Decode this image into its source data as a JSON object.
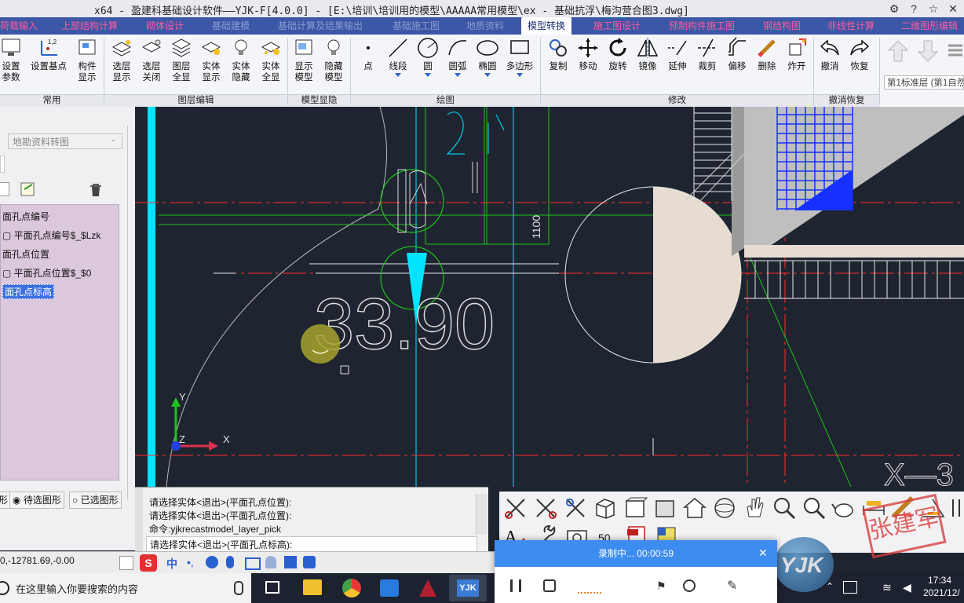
{
  "window": {
    "title": "x64 - 盈建科基础设计软件——YJK-F[4.0.0] - [E:\\培训\\培训用的模型\\AAAAA常用模型\\ex - 基础抗浮\\梅沟营合图3.dwg]"
  },
  "tabs": [
    {
      "label": "荷载输入"
    },
    {
      "label": "上部结构计算"
    },
    {
      "label": "砌体设计"
    },
    {
      "label": "基础建模"
    },
    {
      "label": "基础计算及结果输出"
    },
    {
      "label": "基础施工图"
    },
    {
      "label": "地质资料"
    },
    {
      "label": "模型转换"
    },
    {
      "label": "施工图设计"
    },
    {
      "label": "预制构件施工图"
    },
    {
      "label": "钢结构图"
    },
    {
      "label": "非线性计算"
    },
    {
      "label": "二维图形编辑"
    }
  ],
  "ribbon": {
    "buttons": {
      "set_params": "设置\n参数",
      "set_base": "设置基点",
      "component_show": "构件\n显示",
      "select_layer_show": "选层\n显示",
      "select_layer_close": "选层\n关闭",
      "layer_all": "图层\n全显",
      "entity_show": "实体\n显示",
      "entity_hide": "实体\n隐藏",
      "entity_all": "实体\n全显",
      "show_model": "显示\n模型",
      "hide_model": "隐藏\n模型",
      "point": "点",
      "line": "线段",
      "circle": "圆",
      "arc": "圆弧",
      "ellipse": "椭圆",
      "polygon": "多边形",
      "copy": "复制",
      "move": "移动",
      "rotate": "旋转",
      "mirror": "镜像",
      "extend": "延伸",
      "trim": "裁剪",
      "offset": "偏移",
      "delete": "删除",
      "explode": "炸开",
      "undo": "撤消",
      "redo": "恢复"
    },
    "groups": {
      "common": "常用",
      "layer_edit": "图层编辑",
      "model_hide": "模型显隐",
      "draw": "绘图",
      "modify": "修改",
      "undo_redo": "撤消恢复"
    },
    "floor": "第1标准层 (第1自然"
  },
  "left_panel": {
    "combo": "地勘资料转图",
    "layers": [
      "面孔点编号",
      "平面孔点编号$_$Lzk",
      "面孔点位置",
      "平面孔点位置$_$0",
      "面孔点标高"
    ],
    "radio_pending": "待选图形",
    "radio_selected": "已选图形"
  },
  "canvas": {
    "big_text": "33.90",
    "label_1100": "1100",
    "label_x3": "X—3"
  },
  "command": {
    "lines": [
      "请选择实体<退出>(平面孔点位置):",
      "请选择实体<退出>(平面孔点位置):",
      "命令:yjkrecastmodel_layer_pick",
      "请选择实体<退出>(平面孔点标高):"
    ]
  },
  "status": {
    "coords": "0,-12781.69,-0.00",
    "ime": "中"
  },
  "taskbar": {
    "search_placeholder": "在这里输入你要搜索的内容",
    "time": "17:34",
    "date": "2021/12/"
  },
  "recording": {
    "status": "录制中... 00:00:59"
  },
  "watermark": {
    "brand": "YJK",
    "seal": "张建军"
  },
  "colors": {
    "canvas_bg": "#1f2530",
    "tab_bar": "#3c57a6",
    "tab_text": "#ff5a9e",
    "cyan": "#00e5ff",
    "red_dash": "#ff2a2a",
    "green_line": "#20c020",
    "layer_list_bg": "#dcc8dc",
    "selection_blue": "#3b6fe0"
  }
}
